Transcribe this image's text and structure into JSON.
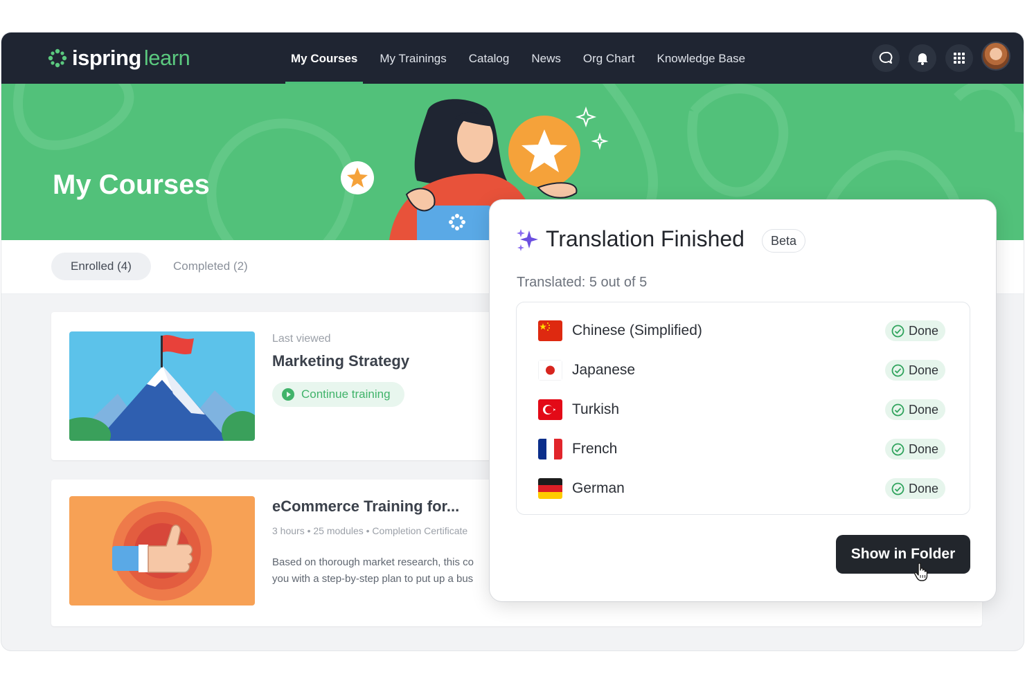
{
  "brand": {
    "name_bold": "ispring",
    "name_light": "learn"
  },
  "nav": {
    "items": [
      {
        "label": "My Courses",
        "active": true
      },
      {
        "label": "My Trainings",
        "active": false
      },
      {
        "label": "Catalog",
        "active": false
      },
      {
        "label": "News",
        "active": false
      },
      {
        "label": "Org Chart",
        "active": false
      },
      {
        "label": "Knowledge Base",
        "active": false
      }
    ],
    "icons": [
      "chat-icon",
      "bell-icon",
      "apps-grid-icon",
      "user-avatar"
    ]
  },
  "hero": {
    "title": "My Courses"
  },
  "tabs": [
    {
      "label": "Enrolled (4)",
      "active": true
    },
    {
      "label": "Completed (2)",
      "active": false
    }
  ],
  "courses": [
    {
      "meta": "Last viewed",
      "title": "Marketing Strategy",
      "action": "Continue training"
    },
    {
      "title": "eCommerce Training for...",
      "meta": "3 hours • 25 modules  •  Completion Certificate",
      "description_line1": "Based on thorough market research, this co",
      "description_line2": "you with a step-by-step plan to put up a bus"
    }
  ],
  "dialog": {
    "title": "Translation Finished",
    "badge": "Beta",
    "summary": "Translated: 5 out of 5",
    "languages": [
      {
        "name": "Chinese (Simplified)",
        "status": "Done",
        "flag": "china-flag"
      },
      {
        "name": "Japanese",
        "status": "Done",
        "flag": "japan-flag"
      },
      {
        "name": "Turkish",
        "status": "Done",
        "flag": "turkey-flag"
      },
      {
        "name": "French",
        "status": "Done",
        "flag": "france-flag"
      },
      {
        "name": "German",
        "status": "Done",
        "flag": "germany-flag"
      }
    ],
    "primary_button": "Show in Folder"
  },
  "colors": {
    "nav_bg": "#1f2532",
    "brand_green": "#52c17a",
    "done_bg": "#e6f5ec",
    "button_dark": "#22262c"
  }
}
